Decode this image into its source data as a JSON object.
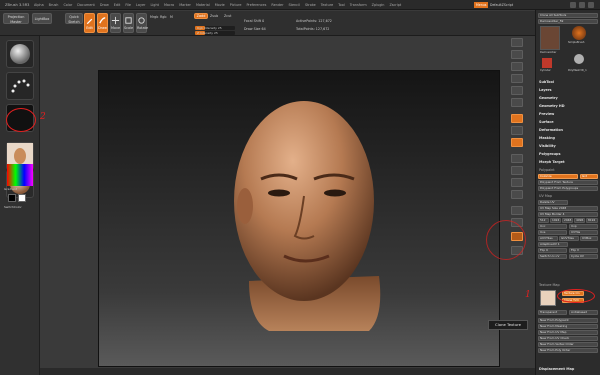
{
  "app": {
    "title": "ZBrush 3.5R3"
  },
  "menu": {
    "items": [
      "Alpha",
      "Brush",
      "Color",
      "Document",
      "Draw",
      "Edit",
      "File",
      "Layer",
      "Light",
      "Macro",
      "Marker",
      "Material",
      "Movie",
      "Picture",
      "Preferences",
      "Render",
      "Stencil",
      "Stroke",
      "Texture",
      "Tool",
      "Transform",
      "Zplugin",
      "Zscript"
    ],
    "menus_button": "Menus",
    "ui_button": "DefaultZScript"
  },
  "toolbar": {
    "projection_master": "Projection Master",
    "lightbox": "LightBox",
    "quick_sketch": "Quick Sketch",
    "edit": "Edit",
    "draw": "Draw",
    "move": "Move",
    "scale": "Scale",
    "rotate": "Rotate",
    "mrgb": "Mrgb",
    "rgb": "Rgb",
    "m": "M",
    "zadd": "Zadd",
    "zsub": "Zsub",
    "zcut": "Zcut",
    "rgb_intensity": "Rgb Intensity 25",
    "rgb_intensity_level": 0.25,
    "z_intensity": "Z Intensity 25",
    "z_intensity_level": 0.25,
    "focal_shift": "Focal Shift 0",
    "draw_size": "Draw Size 64",
    "active_points": "ActivePoints: 127,672",
    "total_points": "TotalPoints: 127,672"
  },
  "left_shelf": {
    "material_label": "SkinShade4",
    "gradient_label": "Gradient",
    "switch_color_label": "SwitchColor"
  },
  "right_panel": {
    "header": "Clone All SubTools",
    "tool_name": "Demosoldier_59",
    "thumbs": [
      "Demosoldier",
      "SimpleBrush",
      "Cylinder",
      "PolyMesh3D_1"
    ],
    "sections": [
      "SubTool",
      "Layers",
      "Geometry",
      "Geometry HD",
      "Preview",
      "Surface",
      "Deformation",
      "Masking",
      "Visibility",
      "Polygroups",
      "Morph Target"
    ],
    "polypaint": {
      "title": "Polypaint",
      "colorize": "Colorize",
      "grd": "Grd",
      "from_texture": "Polypaint From Texture",
      "from_polygroups": "Polypaint From Polygroups"
    },
    "uv_map": {
      "title": "UV Map",
      "delete_uv": "Delete UV",
      "uv_map_size": "UV Map Size 2048",
      "uv_map_border": "UV Map Border 4",
      "sizes": [
        "512",
        "1024",
        "2048",
        "4096",
        "8192"
      ],
      "uvc": "Uvc",
      "uvp": "Uvp",
      "uvs": "Uvs",
      "uvtile": "UVTile",
      "auvtiles": "AUVTiles",
      "guvtiles": "GUVTiles",
      "uvbox": "UVBox",
      "adaptive": "AdaptiveUV 1",
      "flip_u": "Flip U",
      "flip_v": "Flip V",
      "switch_uv": "Switch U<>V",
      "cycle_uv": "Cycle UV"
    },
    "texture_map": {
      "title": "Texture Map",
      "new_texture": "Texture On",
      "clone_texture": "Clone Txtr",
      "transparent": "Transparent",
      "antialiased": "Antialiased",
      "new_from_polypaint": "New From Polypaint",
      "new_from_masking": "New From Masking",
      "new_from_uv_map": "New From UV Map",
      "new_from_uv_check": "New From UV Check",
      "new_from_vertex_order": "New From Vertex Order",
      "new_from_poly_order": "New From Poly Order"
    },
    "displacement_map": "Displacement Map"
  },
  "canvas": {
    "tooltip": "Clone Texture"
  },
  "annotations": {
    "marker_1": "1",
    "marker_2": "2"
  },
  "colors": {
    "accent": "#e0731e",
    "annotation": "#e02020"
  },
  "icons": [
    "sphere-brush-icon",
    "dots-stroke-icon",
    "alpha-icon",
    "texture-thumbnail-icon",
    "material-sphere-icon",
    "color-picker-icon",
    "brush-icon",
    "head-tool-icon"
  ]
}
